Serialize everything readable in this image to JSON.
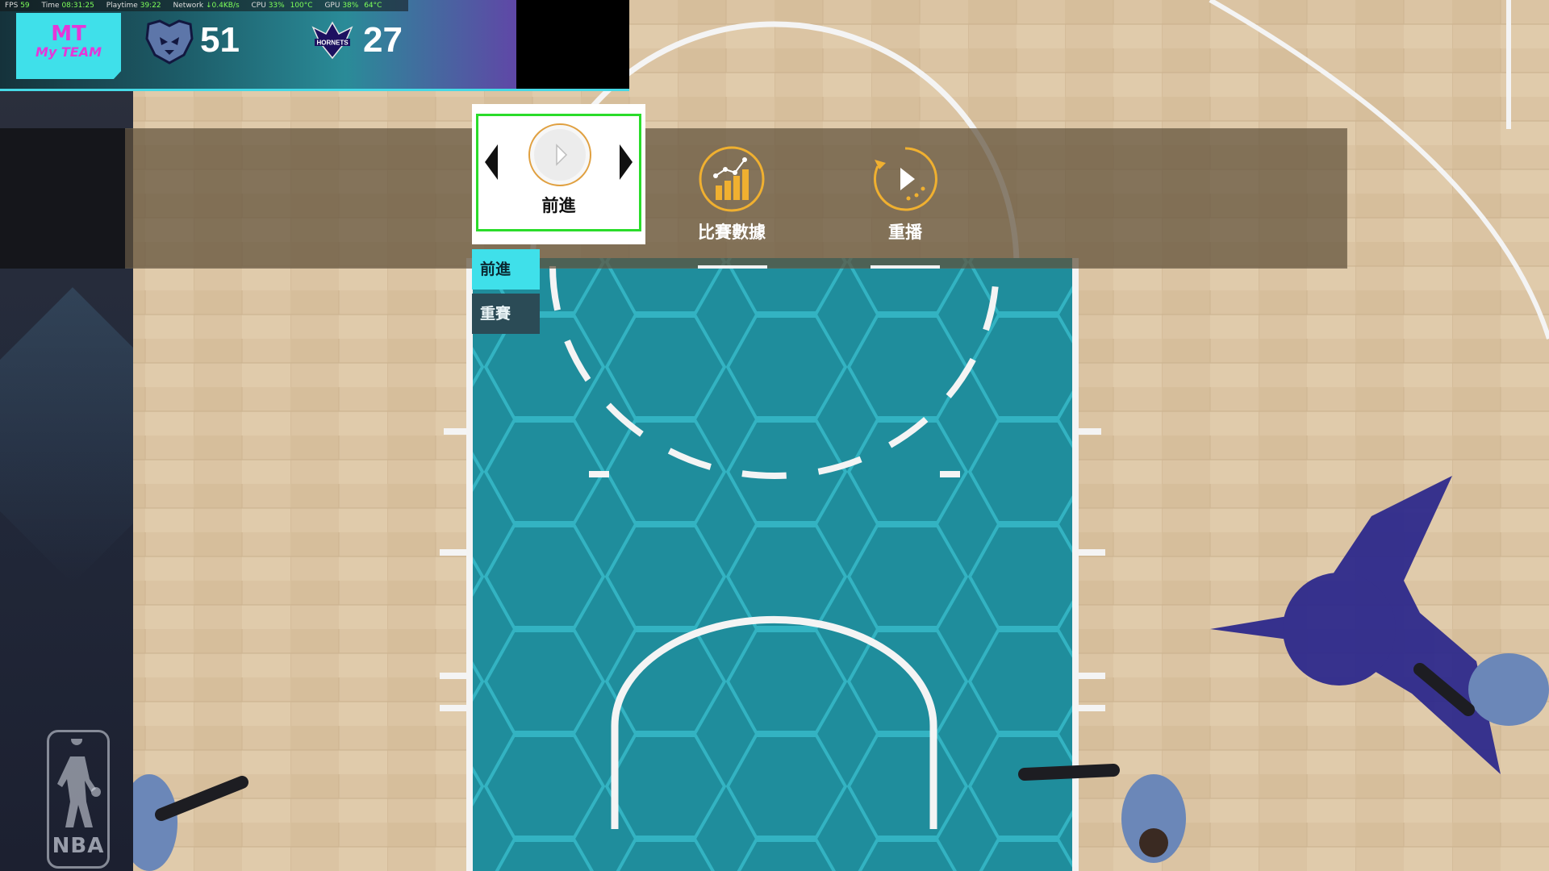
{
  "perf_overlay": {
    "fps_label": "FPS",
    "fps": "59",
    "time_label": "Time",
    "time": "08:31:25",
    "playtime_label": "Playtime",
    "playtime": "39:22",
    "network_label": "Network",
    "network": "↓0.4KB/s",
    "cpu_label": "CPU",
    "cpu": "33%",
    "cpu_temp": "100°C",
    "gpu_label": "GPU",
    "gpu": "38%",
    "gpu_temp": "64°C"
  },
  "scoreboard": {
    "mode_logo_line1": "MT",
    "mode_logo_line2": "My TEAM",
    "home_team_logo": "grizzlies-logo",
    "home_score": "51",
    "away_team_logo": "hornets-logo",
    "away_logo_text": "HORNETS",
    "away_score": "27"
  },
  "pause_menu": {
    "items": [
      {
        "label": "前進",
        "icon": "play-circle-icon",
        "selected": true
      },
      {
        "label": "比賽數據",
        "icon": "bar-chart-icon",
        "selected": false
      },
      {
        "label": "重播",
        "icon": "replay-icon",
        "selected": false
      }
    ],
    "submenu": [
      {
        "label": "前進",
        "active": true
      },
      {
        "label": "重賽",
        "active": false
      }
    ]
  },
  "side_panel": {
    "logo_text": "NBA"
  },
  "colors": {
    "accent_cyan": "#3fe0ea",
    "selection_green": "#2bdc2b",
    "gold_icon": "#f0b030",
    "court_teal": "#1e8c9a",
    "hornets_purple": "#2e2a8c"
  }
}
